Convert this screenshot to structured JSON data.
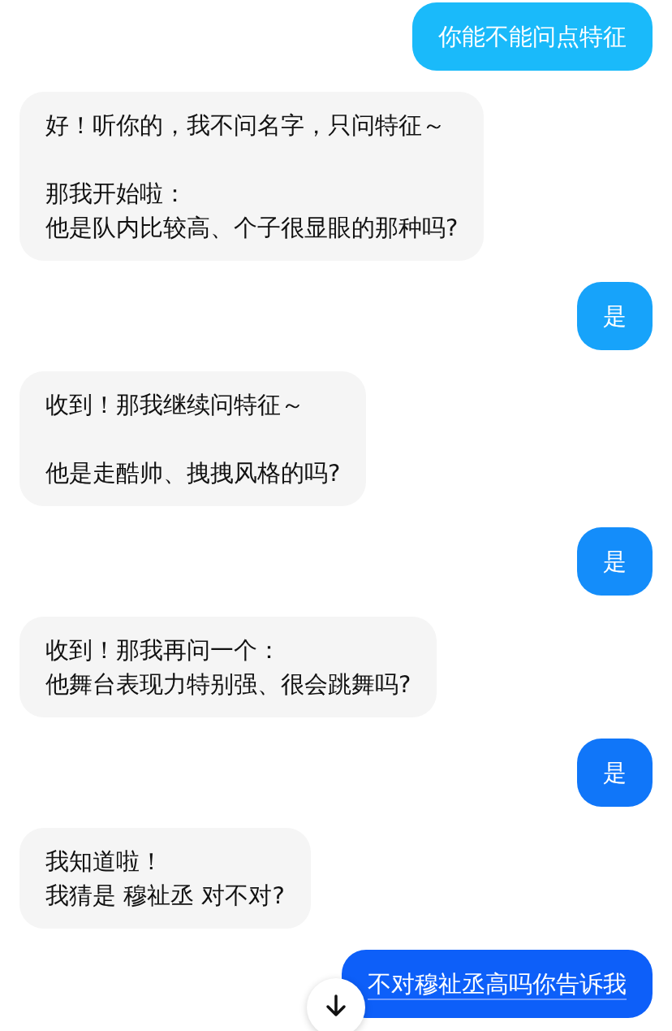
{
  "messages": [
    {
      "kind": "user",
      "text": "你能不能问点特征",
      "underlined": false
    },
    {
      "kind": "assistant",
      "paragraphs": [
        [
          "好！听你的，我不问名字，只问特征～"
        ],
        [
          "那我开始啦：",
          "他是队内比较高、个子很显眼的那种吗?"
        ]
      ]
    },
    {
      "kind": "user",
      "text": "是",
      "underlined": false
    },
    {
      "kind": "assistant",
      "paragraphs": [
        [
          "收到！那我继续问特征～"
        ],
        [
          "他是走酷帅、拽拽风格的吗?"
        ]
      ]
    },
    {
      "kind": "user",
      "text": "是",
      "underlined": false
    },
    {
      "kind": "assistant",
      "paragraphs": [
        [
          "收到！那我再问一个：",
          "他舞台表现力特别强、很会跳舞吗?"
        ]
      ]
    },
    {
      "kind": "user",
      "text": "是",
      "underlined": false
    },
    {
      "kind": "assistant",
      "paragraphs": [
        [
          "我知道啦！",
          "我猜是 穆祉丞 对不对?"
        ]
      ]
    },
    {
      "kind": "user",
      "text": "不对穆祉丞高吗你告诉我",
      "underlined": true
    }
  ]
}
